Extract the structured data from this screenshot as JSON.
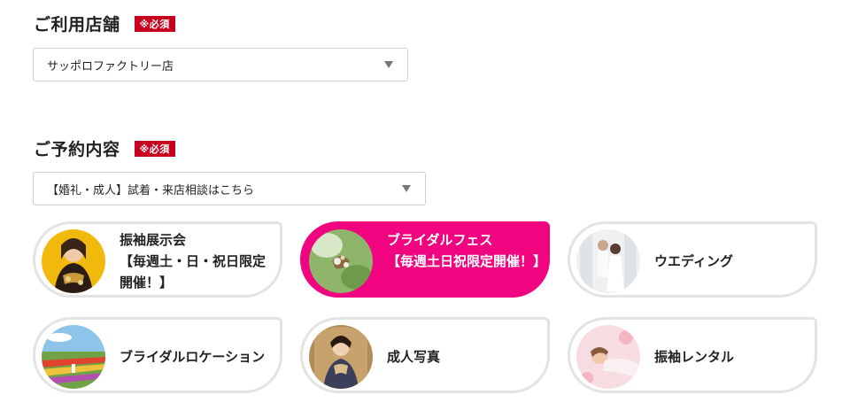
{
  "store": {
    "title": "ご利用店舗",
    "required": "※必須",
    "selected": "サッポロファクトリー店"
  },
  "reservation": {
    "title": "ご予約内容",
    "required": "※必須",
    "selected": "【婚礼・成人】試着・来店相談はこちら"
  },
  "options": [
    {
      "label": "振袖展示会\n【毎週土・日・祝日限定開催！】",
      "active": false,
      "image": "woman-in-kimono-yellow-background"
    },
    {
      "label": "ブライダルフェス\n【毎週土日祝限定開催！】",
      "active": true,
      "image": "bridal-flowers-green"
    },
    {
      "label": "ウエディング",
      "active": false,
      "image": "wedding-couple"
    },
    {
      "label": "ブライダルロケーション",
      "active": false,
      "image": "flower-field-couple"
    },
    {
      "label": "成人写真",
      "active": false,
      "image": "woman-in-kimono-portrait"
    },
    {
      "label": "振袖レンタル",
      "active": false,
      "image": "woman-lying-pink"
    }
  ],
  "colors": {
    "accent": "#f0047f",
    "badge": "#c8001e",
    "border": "#e3e3e3"
  }
}
